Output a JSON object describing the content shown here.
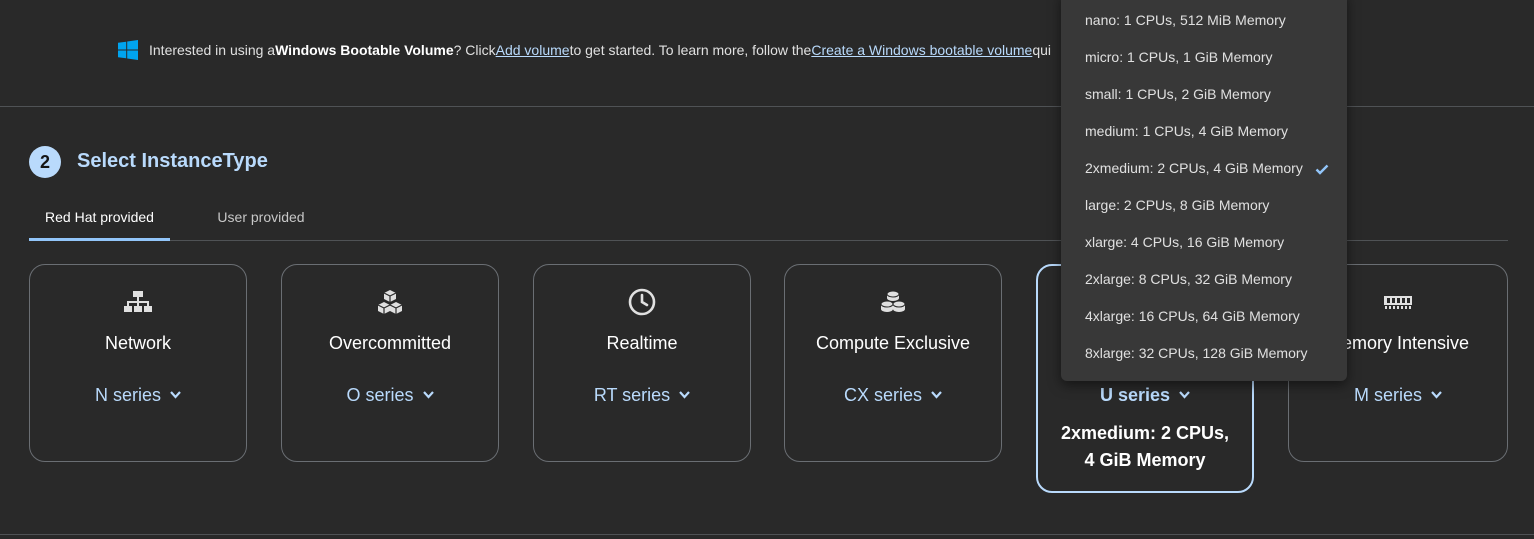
{
  "banner": {
    "pre": "Interested in using a ",
    "bold": "Windows Bootable Volume",
    "mid1": "? Click ",
    "link1": "Add volume",
    "mid2": " to get started. To learn more, follow the ",
    "link2": "Create a Windows bootable volume",
    "tail": " qui"
  },
  "section": {
    "step": "2",
    "title": "Select InstanceType"
  },
  "tabs": [
    {
      "label": "Red Hat provided",
      "active": true
    },
    {
      "label": "User provided",
      "active": false
    }
  ],
  "cards": [
    {
      "name": "Network",
      "series": "N series",
      "icon": "network-icon"
    },
    {
      "name": "Overcommitted",
      "series": "O series",
      "icon": "cubes-icon"
    },
    {
      "name": "Realtime",
      "series": "RT series",
      "icon": "clock-icon"
    },
    {
      "name": "Compute Exclusive",
      "series": "CX series",
      "icon": "stacked-disks-icon"
    },
    {
      "name": "",
      "series": "U series",
      "icon": "",
      "detail_line1": "2xmedium: 2 CPUs,",
      "detail_line2": "4 GiB Memory"
    },
    {
      "name": "emory Intensive",
      "series": "M series",
      "icon": "memory-icon"
    }
  ],
  "menu": {
    "items": [
      {
        "label": "nano: 1 CPUs, 512 MiB Memory",
        "selected": false
      },
      {
        "label": "micro: 1 CPUs, 1 GiB Memory",
        "selected": false
      },
      {
        "label": "small: 1 CPUs, 2 GiB Memory",
        "selected": false
      },
      {
        "label": "medium: 1 CPUs, 4 GiB Memory",
        "selected": false
      },
      {
        "label": "2xmedium: 2 CPUs, 4 GiB Memory",
        "selected": true
      },
      {
        "label": "large: 2 CPUs, 8 GiB Memory",
        "selected": false
      },
      {
        "label": "xlarge: 4 CPUs, 16 GiB Memory",
        "selected": false
      },
      {
        "label": "2xlarge: 8 CPUs, 32 GiB Memory",
        "selected": false
      },
      {
        "label": "4xlarge: 16 CPUs, 64 GiB Memory",
        "selected": false
      },
      {
        "label": "8xlarge: 32 CPUs, 128 GiB Memory",
        "selected": false
      }
    ]
  },
  "colors": {
    "background": "#292929",
    "accent": "#b9dafc",
    "windows_blue": "#00a4ef"
  }
}
